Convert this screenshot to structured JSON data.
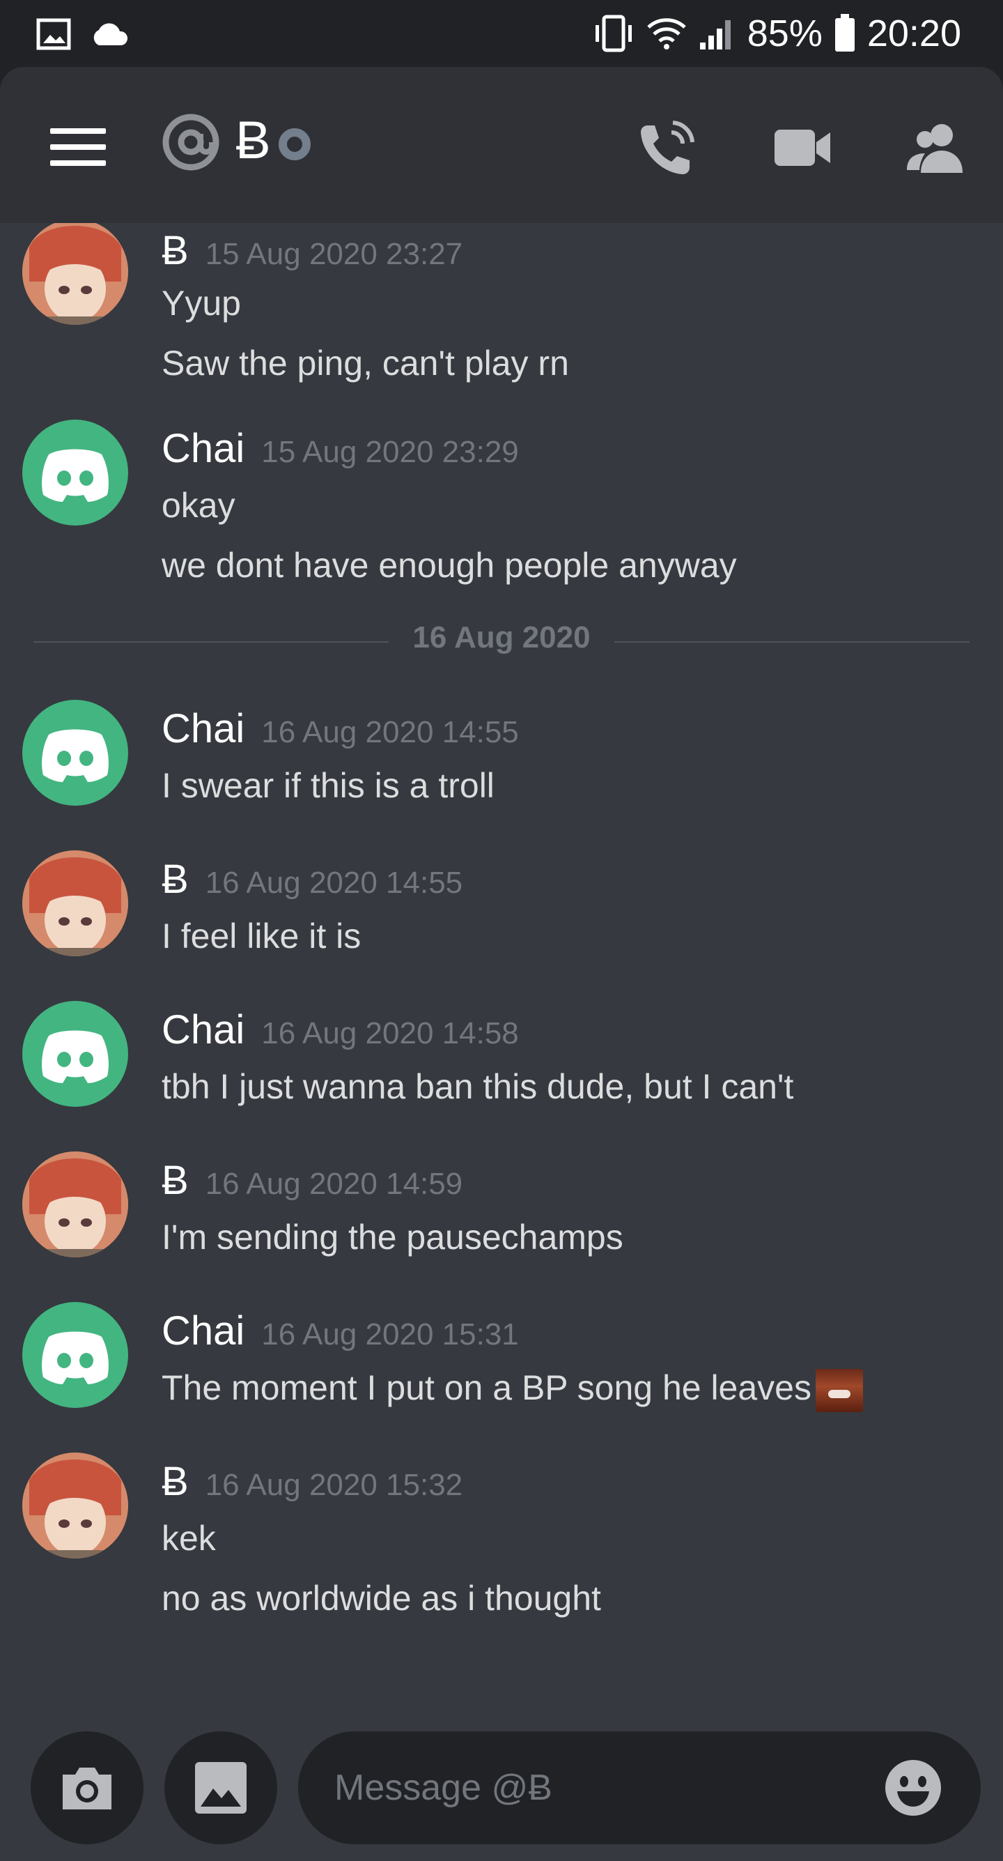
{
  "status_bar": {
    "battery": "85%",
    "time": "20:20"
  },
  "header": {
    "channel_name": "Ƀ"
  },
  "messages": [
    {
      "author": "Ƀ",
      "timestamp": "15 Aug 2020 23:27",
      "lines": [
        "Yyup",
        "Saw the ping, can't play rn"
      ],
      "avatar": "anime"
    },
    {
      "author": "Chai",
      "timestamp": "15 Aug 2020 23:29",
      "lines": [
        "okay",
        "we dont have enough people anyway"
      ],
      "avatar": "discord"
    },
    {
      "author": "Chai",
      "timestamp": "16 Aug 2020 14:55",
      "lines": [
        "I swear if this is a troll"
      ],
      "avatar": "discord"
    },
    {
      "author": "Ƀ",
      "timestamp": "16 Aug 2020 14:55",
      "lines": [
        "I feel like it is"
      ],
      "avatar": "anime"
    },
    {
      "author": "Chai",
      "timestamp": "16 Aug 2020 14:58",
      "lines": [
        "tbh I just wanna ban this dude, but I can't"
      ],
      "avatar": "discord"
    },
    {
      "author": "Ƀ",
      "timestamp": "16 Aug 2020 14:59",
      "lines": [
        "I'm sending the pausechamps"
      ],
      "avatar": "anime"
    },
    {
      "author": "Chai",
      "timestamp": "16 Aug 2020 15:31",
      "lines": [
        "The moment I put on a BP song he leaves"
      ],
      "avatar": "discord"
    },
    {
      "author": "Ƀ",
      "timestamp": "16 Aug 2020 15:32",
      "lines": [
        "kek",
        "no as worldwide as i thought"
      ],
      "avatar": "anime"
    }
  ],
  "date_divider": "16 Aug 2020",
  "composer": {
    "placeholder": "Message @Ƀ"
  },
  "colors": {
    "background": "#36393f",
    "header": "#2f3136",
    "statusbar": "#202225",
    "discord_green": "#43b581",
    "timestamp": "#72767d"
  },
  "icons": [
    "image-icon",
    "cloud-icon",
    "vibrate-icon",
    "wifi-icon",
    "signal-icon",
    "battery-icon",
    "menu-icon",
    "at-icon",
    "status-offline-icon",
    "call-icon",
    "video-icon",
    "members-icon",
    "camera-icon",
    "gallery-icon",
    "emoji-icon"
  ]
}
